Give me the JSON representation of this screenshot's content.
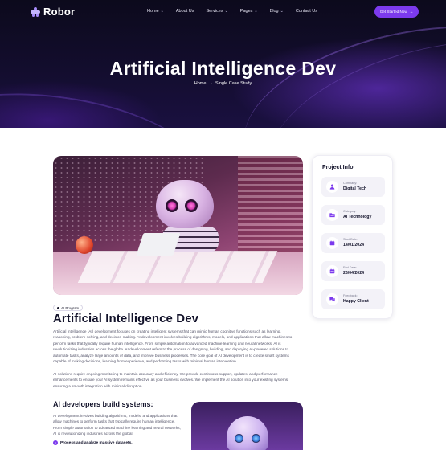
{
  "brand": {
    "name": "Robor"
  },
  "nav": {
    "items": [
      {
        "label": "Home",
        "dropdown": true
      },
      {
        "label": "About Us",
        "dropdown": false
      },
      {
        "label": "Services",
        "dropdown": true
      },
      {
        "label": "Pages",
        "dropdown": true
      },
      {
        "label": "Blog",
        "dropdown": true
      },
      {
        "label": "Contact Us",
        "dropdown": false
      }
    ],
    "cta_label": "Get Started Now",
    "chevron": "⌄",
    "cta_arrow": "→"
  },
  "hero": {
    "title": "Artificial Intelligence Dev",
    "breadcrumb_home": "Home",
    "breadcrumb_separator": "→",
    "breadcrumb_current": "Single Case Study"
  },
  "article": {
    "tag": "AI Program",
    "title": "Artificial Intelligence Dev",
    "paragraph_1": "Artificial Intelligence (AI) development focuses on creating intelligent systems that can mimic human cognitive functions such as learning, reasoning, problem-solving, and decision-making. AI development involves building algorithms, models, and applications that allow machines to perform tasks that typically require human intelligence. From simple automation to advanced machine learning and neural networks, AI is revolutionizing industries across the globe. AI development refers to the process of designing, building, and deploying AI-powered solutions to automate tasks, analyze large amounts of data, and improve business processes. The core goal of AI development is to create smart systems capable of making decisions, learning from experience, and performing tasks with minimal human intervention.",
    "paragraph_2": "AI solutions require ongoing monitoring to maintain accuracy and efficiency. We provide continuous support, updates, and performance enhancements to ensure your AI system remains effective as your business evolves. We implement the AI solution into your existing systems, ensuring a smooth integration with minimal disruption.",
    "subtitle": "AI developers build systems:",
    "paragraph_3": "AI development involves building algorithms, models, and applications that allow machines to perform tasks that typically require human intelligence. From simple automation to advanced machine learning and neural networks, AI is revolutionizing industries across the global.",
    "bullet_1": "Process and analyze massive datasets."
  },
  "project_info": {
    "title": "Project Info",
    "items": [
      {
        "label": "Company:",
        "value": "Digital Tech",
        "icon": "user-icon"
      },
      {
        "label": "Category:",
        "value": "AI Technology",
        "icon": "folder-icon"
      },
      {
        "label": "Start Date:",
        "value": "14/01/2024",
        "icon": "calendar-icon"
      },
      {
        "label": "End Date:",
        "value": "26/04/2024",
        "icon": "calendar-icon"
      },
      {
        "label": "Feedback:",
        "value": "Happy Client",
        "icon": "chat-icon"
      }
    ]
  },
  "colors": {
    "accent": "#7c3aed",
    "hero_bg": "#130d2e",
    "heading": "#12122a",
    "body_text": "#55556a",
    "card_item_bg": "#f3f2f8"
  }
}
